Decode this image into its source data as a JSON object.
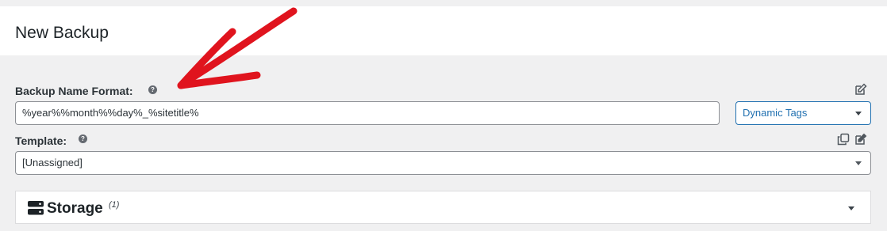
{
  "header": {
    "title": "New Backup"
  },
  "backup_name": {
    "label": "Backup Name Format:",
    "help": "?",
    "value": "%year%%month%%day%_%sitetitle%",
    "tags_select": "Dynamic Tags"
  },
  "template": {
    "label": "Template:",
    "help": "?",
    "value": "[Unassigned]"
  },
  "storage": {
    "title": "Storage",
    "count": "(1)"
  },
  "icons": {
    "edit": "edit-icon",
    "copy": "copy-icon",
    "storage": "server-icon",
    "annotation": "red-arrow-annotation"
  },
  "colors": {
    "accent": "#2271b1",
    "annotation": "#e0141e"
  }
}
